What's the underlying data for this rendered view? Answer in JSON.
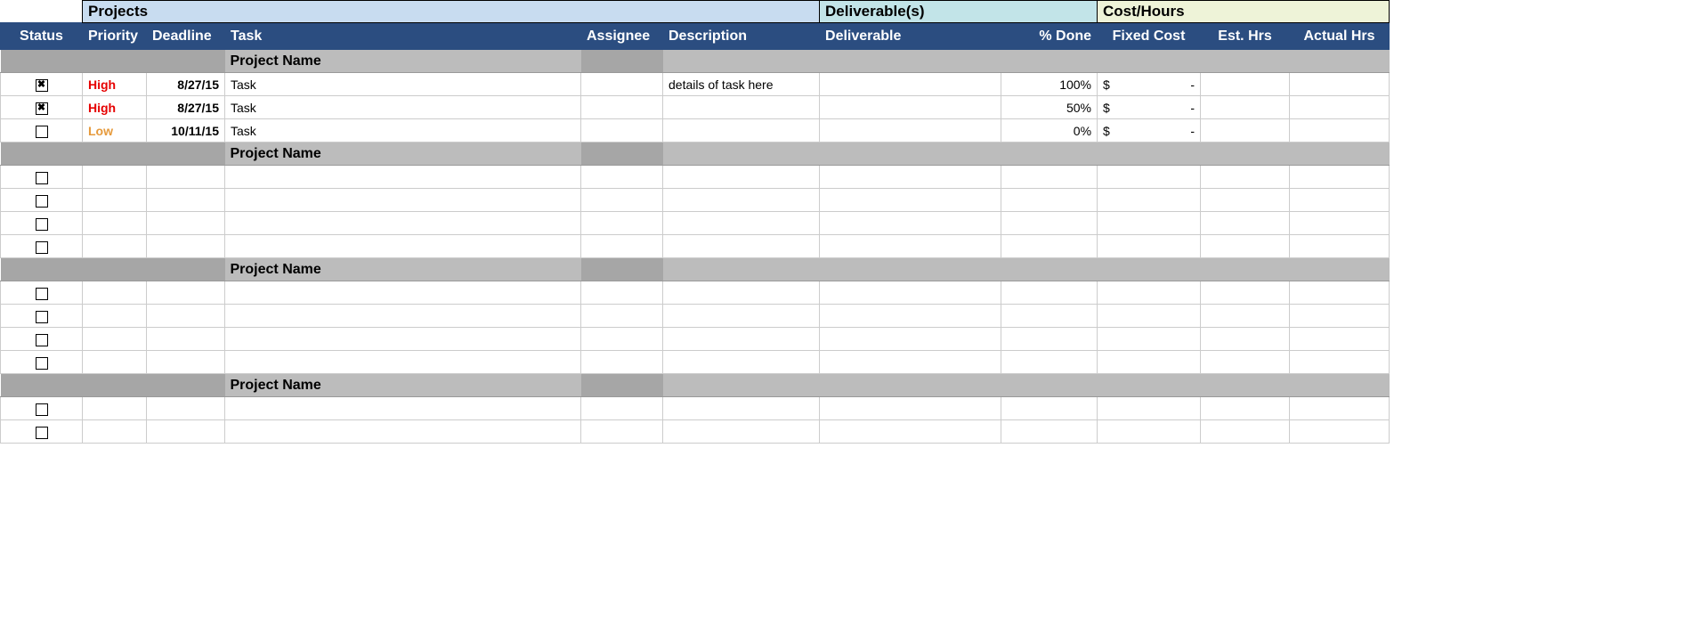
{
  "sections": {
    "projects": "Projects",
    "deliverables": "Deliverable(s)",
    "cost": "Cost/Hours"
  },
  "columns": {
    "status": "Status",
    "priority": "Priority",
    "deadline": "Deadline",
    "task": "Task",
    "assignee": "Assignee",
    "description": "Description",
    "deliverable": "Deliverable",
    "pct_done": "% Done",
    "fixed_cost": "Fixed Cost",
    "est_hrs": "Est. Hrs",
    "actual_hrs": "Actual Hrs"
  },
  "currency_symbol": "$",
  "dash": "-",
  "groups": [
    {
      "name": "Project Name",
      "rows": [
        {
          "checked": true,
          "priority": "High",
          "deadline": "8/27/15",
          "task": "Task",
          "assignee": "",
          "description": "details of task here",
          "deliverable": "",
          "pct_done": "100%",
          "fixed_cost": "-",
          "est_hrs": "",
          "actual_hrs": ""
        },
        {
          "checked": true,
          "priority": "High",
          "deadline": "8/27/15",
          "task": "Task",
          "assignee": "",
          "description": "",
          "deliverable": "",
          "pct_done": "50%",
          "fixed_cost": "-",
          "est_hrs": "",
          "actual_hrs": ""
        },
        {
          "checked": false,
          "priority": "Low",
          "deadline": "10/11/15",
          "task": "Task",
          "assignee": "",
          "description": "",
          "deliverable": "",
          "pct_done": "0%",
          "fixed_cost": "-",
          "est_hrs": "",
          "actual_hrs": ""
        }
      ]
    },
    {
      "name": "Project Name",
      "rows": [
        {
          "checked": false,
          "priority": "",
          "deadline": "",
          "task": "",
          "assignee": "",
          "description": "",
          "deliverable": "",
          "pct_done": "",
          "fixed_cost": "",
          "est_hrs": "",
          "actual_hrs": ""
        },
        {
          "checked": false,
          "priority": "",
          "deadline": "",
          "task": "",
          "assignee": "",
          "description": "",
          "deliverable": "",
          "pct_done": "",
          "fixed_cost": "",
          "est_hrs": "",
          "actual_hrs": ""
        },
        {
          "checked": false,
          "priority": "",
          "deadline": "",
          "task": "",
          "assignee": "",
          "description": "",
          "deliverable": "",
          "pct_done": "",
          "fixed_cost": "",
          "est_hrs": "",
          "actual_hrs": ""
        },
        {
          "checked": false,
          "priority": "",
          "deadline": "",
          "task": "",
          "assignee": "",
          "description": "",
          "deliverable": "",
          "pct_done": "",
          "fixed_cost": "",
          "est_hrs": "",
          "actual_hrs": ""
        }
      ]
    },
    {
      "name": "Project Name",
      "rows": [
        {
          "checked": false,
          "priority": "",
          "deadline": "",
          "task": "",
          "assignee": "",
          "description": "",
          "deliverable": "",
          "pct_done": "",
          "fixed_cost": "",
          "est_hrs": "",
          "actual_hrs": ""
        },
        {
          "checked": false,
          "priority": "",
          "deadline": "",
          "task": "",
          "assignee": "",
          "description": "",
          "deliverable": "",
          "pct_done": "",
          "fixed_cost": "",
          "est_hrs": "",
          "actual_hrs": ""
        },
        {
          "checked": false,
          "priority": "",
          "deadline": "",
          "task": "",
          "assignee": "",
          "description": "",
          "deliverable": "",
          "pct_done": "",
          "fixed_cost": "",
          "est_hrs": "",
          "actual_hrs": ""
        },
        {
          "checked": false,
          "priority": "",
          "deadline": "",
          "task": "",
          "assignee": "",
          "description": "",
          "deliverable": "",
          "pct_done": "",
          "fixed_cost": "",
          "est_hrs": "",
          "actual_hrs": ""
        }
      ]
    },
    {
      "name": "Project Name",
      "rows": [
        {
          "checked": false,
          "priority": "",
          "deadline": "",
          "task": "",
          "assignee": "",
          "description": "",
          "deliverable": "",
          "pct_done": "",
          "fixed_cost": "",
          "est_hrs": "",
          "actual_hrs": ""
        },
        {
          "checked": false,
          "priority": "",
          "deadline": "",
          "task": "",
          "assignee": "",
          "description": "",
          "deliverable": "",
          "pct_done": "",
          "fixed_cost": "",
          "est_hrs": "",
          "actual_hrs": ""
        }
      ]
    }
  ]
}
